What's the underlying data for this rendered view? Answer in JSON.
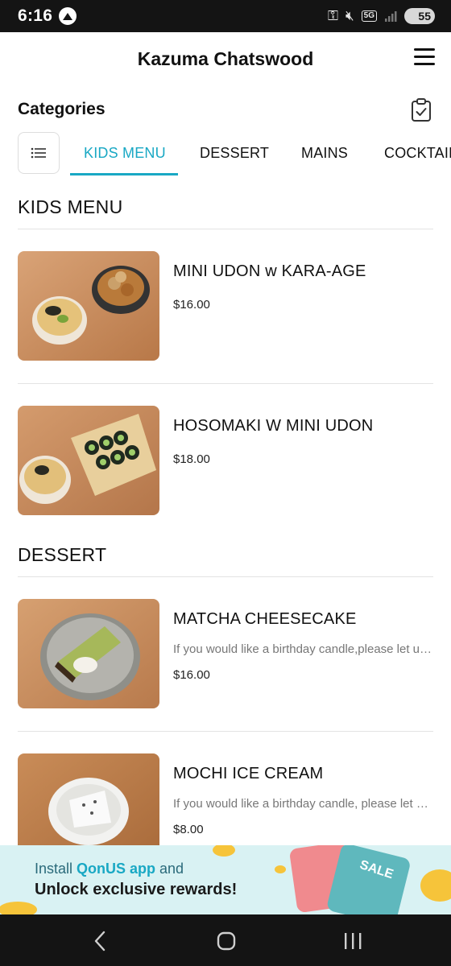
{
  "status_bar": {
    "time": "6:16",
    "network": "5G",
    "battery": "55"
  },
  "header": {
    "title": "Kazuma Chatswood",
    "menu_icon": "hamburger-menu-icon"
  },
  "categories": {
    "title": "Categories",
    "order_icon": "clipboard-check-icon",
    "list_icon": "list-icon",
    "tabs": [
      {
        "label": "KIDS MENU",
        "active": true
      },
      {
        "label": "DESSERT",
        "active": false
      },
      {
        "label": "MAINS",
        "active": false
      },
      {
        "label": "COCKTAILS",
        "active": false
      }
    ]
  },
  "sections": [
    {
      "title": "KIDS MENU",
      "items": [
        {
          "name": "MINI UDON w KARA-AGE",
          "description": "",
          "price": "$16.00"
        },
        {
          "name": "HOSOMAKI W MINI UDON",
          "description": "",
          "price": "$18.00"
        }
      ]
    },
    {
      "title": "DESSERT",
      "items": [
        {
          "name": "MATCHA CHEESECAKE",
          "description": "If you would like a birthday candle,please let us know",
          "price": "$16.00"
        },
        {
          "name": "MOCHI ICE CREAM",
          "description": "If you would like a birthday candle, please let us know",
          "price": "$8.00"
        }
      ]
    }
  ],
  "promo": {
    "line1_prefix": "Install ",
    "line1_app": "QonUS app",
    "line1_suffix": " and",
    "line2": "Unlock exclusive rewards!",
    "badge": "SALE"
  },
  "nav": {
    "back_icon": "back-chevron-icon",
    "home_icon": "home-circle-icon",
    "recents_icon": "recents-icon"
  },
  "colors": {
    "accent": "#19a8c4",
    "status_bar": "#141414",
    "promo_bg": "#d9f2f3"
  }
}
